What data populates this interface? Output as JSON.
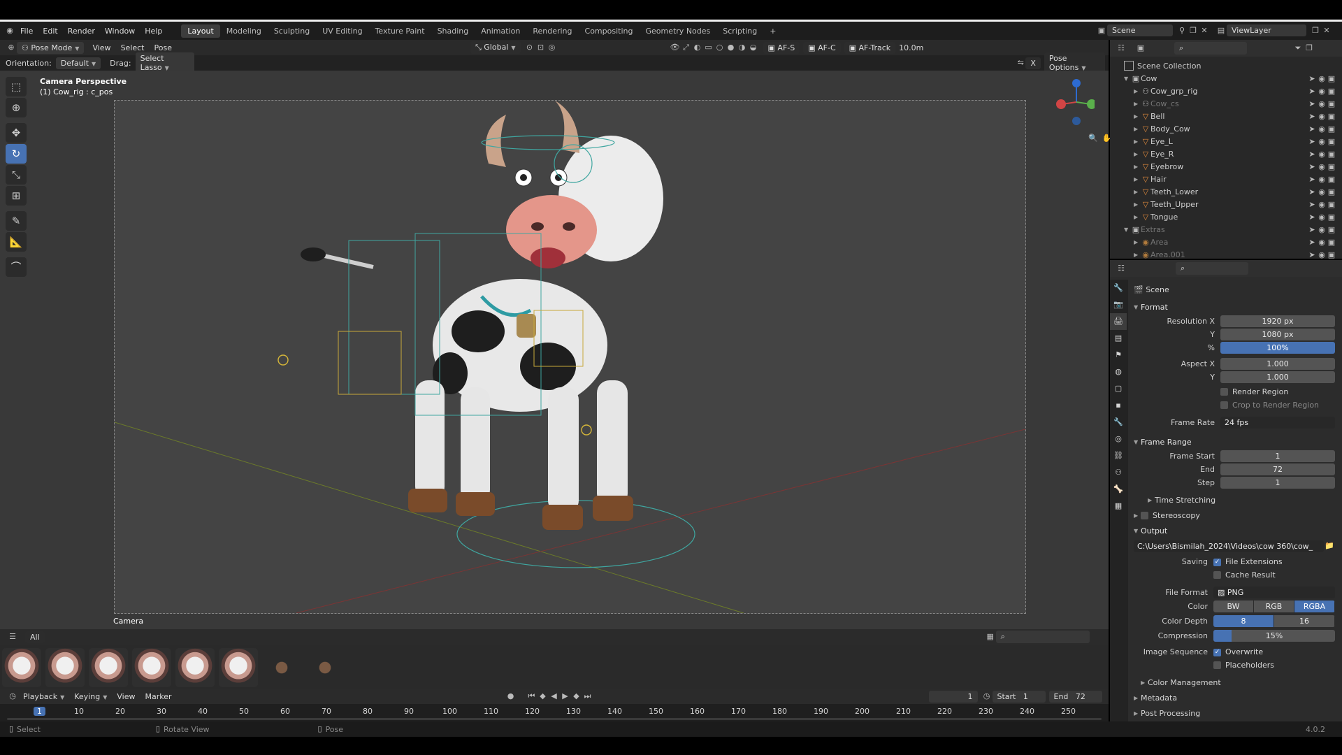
{
  "menu": [
    "File",
    "Edit",
    "Render",
    "Window",
    "Help"
  ],
  "workspaces": [
    "Layout",
    "Modeling",
    "Sculpting",
    "UV Editing",
    "Texture Paint",
    "Shading",
    "Animation",
    "Rendering",
    "Compositing",
    "Geometry Nodes",
    "Scripting"
  ],
  "active_workspace": "Layout",
  "scene_name": "Scene",
  "view_layer": "ViewLayer",
  "viewport_header": {
    "mode": "Pose Mode",
    "menus": [
      "View",
      "Select",
      "Pose"
    ],
    "transform": "Global",
    "af_s": "AF-S",
    "af_c": "AF-C",
    "af_track": "AF-Track",
    "distance": "10.0m"
  },
  "viewport_header2": {
    "orientation_label": "Orientation:",
    "orientation_value": "Default",
    "drag_label": "Drag:",
    "drag_value": "Select Lasso",
    "pose_options": "Pose Options",
    "x_axis": "X"
  },
  "viewport": {
    "view_title": "Camera Perspective",
    "view_subtitle": "(1) Cow_rig : c_pos",
    "camera_label": "Camera"
  },
  "assets": {
    "filter": "All"
  },
  "timeline": {
    "menus": [
      "Playback",
      "Keying",
      "View",
      "Marker"
    ],
    "current_frame": "1",
    "start_label": "Start",
    "start_value": "1",
    "end_label": "End",
    "end_value": "72",
    "ticks": [
      "1",
      "10",
      "20",
      "30",
      "40",
      "50",
      "60",
      "70",
      "80",
      "90",
      "100",
      "110",
      "120",
      "130",
      "140",
      "150",
      "160",
      "170",
      "180",
      "190",
      "200",
      "210",
      "220",
      "230",
      "240",
      "250"
    ]
  },
  "status": {
    "select": "Select",
    "rotate": "Rotate View",
    "pose": "Pose",
    "version": "4.0.2"
  },
  "outliner": {
    "collection_root": "Scene Collection",
    "items": [
      {
        "name": "Cow",
        "type": "collection",
        "dim": false
      },
      {
        "name": "Cow_grp_rig",
        "type": "object",
        "dim": false
      },
      {
        "name": "Cow_cs",
        "type": "object",
        "dim": true
      },
      {
        "name": "Bell",
        "type": "mesh",
        "dim": false
      },
      {
        "name": "Body_Cow",
        "type": "mesh",
        "dim": false
      },
      {
        "name": "Eye_L",
        "type": "mesh",
        "dim": false
      },
      {
        "name": "Eye_R",
        "type": "mesh",
        "dim": false
      },
      {
        "name": "Eyebrow",
        "type": "mesh",
        "dim": false
      },
      {
        "name": "Hair",
        "type": "mesh",
        "dim": false
      },
      {
        "name": "Teeth_Lower",
        "type": "mesh",
        "dim": false
      },
      {
        "name": "Teeth_Upper",
        "type": "mesh",
        "dim": false
      },
      {
        "name": "Tongue",
        "type": "mesh",
        "dim": false
      },
      {
        "name": "Extras",
        "type": "collection",
        "dim": true
      },
      {
        "name": "Area",
        "type": "light",
        "dim": true
      },
      {
        "name": "Area.001",
        "type": "light",
        "dim": true
      }
    ]
  },
  "properties": {
    "context": "Scene",
    "format": {
      "title": "Format",
      "resolution_x_label": "Resolution X",
      "resolution_x": "1920 px",
      "y_label": "Y",
      "resolution_y": "1080 px",
      "pct_label": "%",
      "resolution_pct": "100%",
      "aspect_x_label": "Aspect X",
      "aspect_x": "1.000",
      "aspect_y_label": "Y",
      "aspect_y": "1.000",
      "render_region": "Render Region",
      "crop": "Crop to Render Region",
      "frame_rate_label": "Frame Rate",
      "frame_rate": "24 fps"
    },
    "frame_range": {
      "title": "Frame Range",
      "start_label": "Frame Start",
      "start": "1",
      "end_label": "End",
      "end": "72",
      "step_label": "Step",
      "step": "1"
    },
    "time_stretching": "Time Stretching",
    "stereoscopy": "Stereoscopy",
    "output": {
      "title": "Output",
      "path": "C:\\Users\\Bismilah_2024\\Videos\\cow 360\\cow_",
      "saving_label": "Saving",
      "file_extensions": "File Extensions",
      "cache_result": "Cache Result",
      "file_format_label": "File Format",
      "file_format": "PNG",
      "color_label": "Color",
      "color_options": [
        "BW",
        "RGB",
        "RGBA"
      ],
      "color_selected": "RGBA",
      "depth_label": "Color Depth",
      "depth_options": [
        "8",
        "16"
      ],
      "depth_selected": "8",
      "compression_label": "Compression",
      "compression": "15%",
      "image_sequence_label": "Image Sequence",
      "overwrite": "Overwrite",
      "placeholders": "Placeholders"
    },
    "color_management": "Color Management",
    "metadata": "Metadata",
    "post_processing": "Post Processing"
  },
  "colors": {
    "accent": "#4772b3",
    "viewport_bg": "#393939"
  }
}
